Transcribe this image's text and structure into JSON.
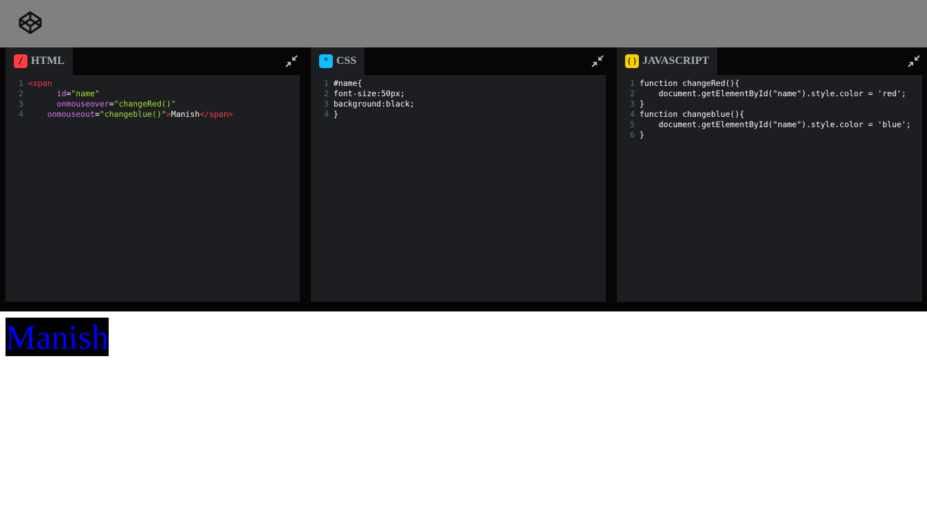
{
  "colors": {
    "topbar": "#808080",
    "editor_bg": "#1d1e22",
    "html_badge": "#ff3c41",
    "css_badge": "#0ebeff",
    "js_badge": "#fcd000",
    "preview_text": "#0000ff"
  },
  "header": {
    "logo_icon": "codepen-logo-icon"
  },
  "panels": {
    "html": {
      "badge": "/",
      "title": "HTML",
      "lines": [
        {
          "n": "1",
          "parts": [
            {
              "t": "<span",
              "c": "tag"
            }
          ]
        },
        {
          "n": "2",
          "parts": [
            {
              "t": "      ",
              "c": "plain"
            },
            {
              "t": "id",
              "c": "attr"
            },
            {
              "t": "=",
              "c": "plain"
            },
            {
              "t": "\"name\"",
              "c": "str"
            }
          ]
        },
        {
          "n": "3",
          "parts": [
            {
              "t": "      ",
              "c": "plain"
            },
            {
              "t": "onmouseover",
              "c": "attr"
            },
            {
              "t": "=",
              "c": "plain"
            },
            {
              "t": "\"changeRed()\"",
              "c": "str"
            }
          ]
        },
        {
          "n": "4",
          "parts": [
            {
              "t": "    ",
              "c": "plain"
            },
            {
              "t": "onmouseout",
              "c": "attr"
            },
            {
              "t": "=",
              "c": "plain"
            },
            {
              "t": "\"changeblue()\"",
              "c": "str"
            },
            {
              "t": ">",
              "c": "tag"
            },
            {
              "t": "Manish",
              "c": "plain"
            },
            {
              "t": "</span>",
              "c": "tag"
            }
          ]
        }
      ]
    },
    "css": {
      "badge": "*",
      "title": "CSS",
      "lines": [
        {
          "n": "1",
          "parts": [
            {
              "t": "#name{",
              "c": "plain"
            }
          ]
        },
        {
          "n": "2",
          "parts": [
            {
              "t": "font-size:50px;",
              "c": "plain"
            }
          ]
        },
        {
          "n": "3",
          "parts": [
            {
              "t": "background:black;",
              "c": "plain"
            }
          ]
        },
        {
          "n": "4",
          "parts": [
            {
              "t": "}",
              "c": "plain"
            }
          ]
        }
      ]
    },
    "js": {
      "badge": "()",
      "title": "JAVASCRIPT",
      "lines": [
        {
          "n": "1",
          "parts": [
            {
              "t": "function changeRed(){",
              "c": "plain"
            }
          ]
        },
        {
          "n": "2",
          "parts": [
            {
              "t": "    document.getElementById(\"name\").style.color = 'red';",
              "c": "plain"
            }
          ]
        },
        {
          "n": "3",
          "parts": [
            {
              "t": "}",
              "c": "plain"
            }
          ]
        },
        {
          "n": "4",
          "parts": [
            {
              "t": "function changeblue(){",
              "c": "plain"
            }
          ]
        },
        {
          "n": "5",
          "parts": [
            {
              "t": "    document.getElementById(\"name\").style.color = 'blue';",
              "c": "plain"
            }
          ]
        },
        {
          "n": "6",
          "parts": [
            {
              "t": "}",
              "c": "plain"
            }
          ]
        }
      ]
    }
  },
  "preview": {
    "text": "Manish"
  }
}
